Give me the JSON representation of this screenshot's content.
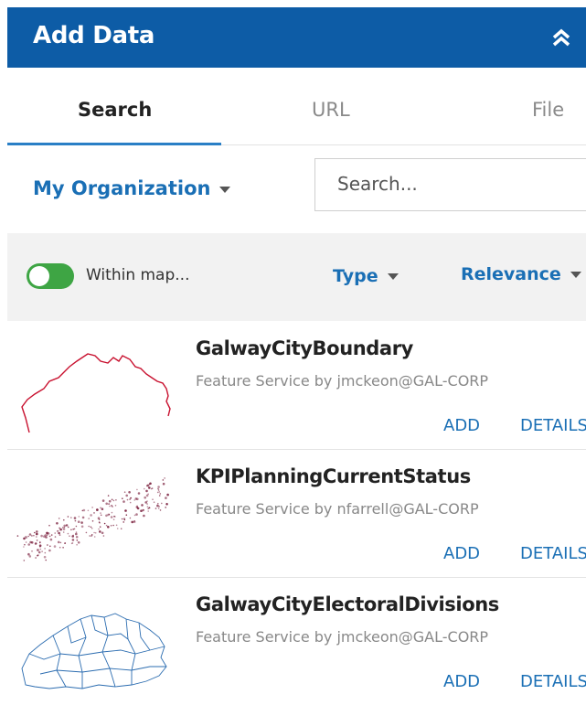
{
  "header": {
    "title": "Add Data",
    "collapse_icon": "double-chevron-up-icon"
  },
  "tabs": [
    {
      "label": "Search",
      "active": true
    },
    {
      "label": "URL",
      "active": false
    },
    {
      "label": "File",
      "active": false
    }
  ],
  "search": {
    "scope": "My Organization",
    "placeholder": "Search...",
    "value": ""
  },
  "filters": {
    "within_map_label": "Within map...",
    "within_map_on": true,
    "type_label": "Type",
    "sort_label": "Relevance"
  },
  "results": [
    {
      "title": "GalwayCityBoundary",
      "subtitle": "Feature Service by jmckeon@GAL-CORP",
      "add": "ADD",
      "details": "DETAILS",
      "thumbnail": "boundary-line-thumbnail"
    },
    {
      "title": "KPIPlanningCurrentStatus",
      "subtitle": "Feature Service by nfarrell@GAL-CORP",
      "add": "ADD",
      "details": "DETAILS",
      "thumbnail": "point-cluster-thumbnail"
    },
    {
      "title": "GalwayCityElectoralDivisions",
      "subtitle": "Feature Service by jmckeon@GAL-CORP",
      "add": "ADD",
      "details": "DETAILS",
      "thumbnail": "polygon-divisions-thumbnail"
    }
  ],
  "colors": {
    "header": "#0d5ca6",
    "accent": "#1a6fb5",
    "toggle_on": "#3ea544",
    "boundary_line": "#c8102e",
    "points": "#7a1f3d",
    "divisions": "#2b6cb0"
  }
}
